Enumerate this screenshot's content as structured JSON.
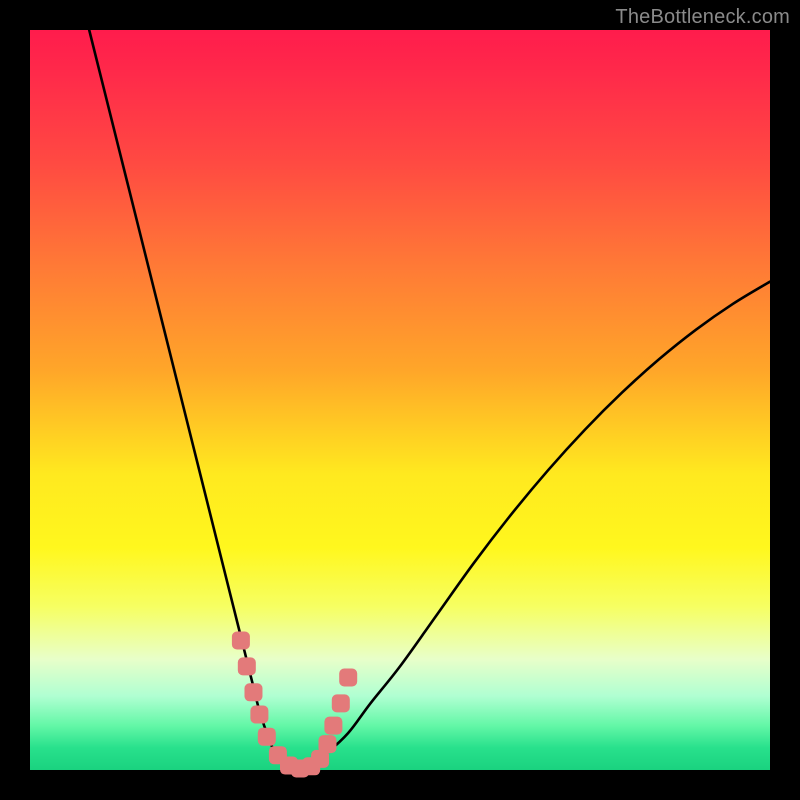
{
  "watermark": "TheBottleneck.com",
  "chart_data": {
    "type": "line",
    "title": "",
    "xlabel": "",
    "ylabel": "",
    "xlim": [
      0,
      100
    ],
    "ylim": [
      0,
      100
    ],
    "grid": false,
    "legend": false,
    "series": [
      {
        "name": "bottleneck-curve",
        "color": "#000000",
        "x": [
          8,
          10,
          12,
          14,
          16,
          18,
          20,
          22,
          24,
          26,
          27,
          28,
          29,
          30,
          31,
          32,
          33,
          34,
          35,
          36,
          37,
          38,
          40,
          43,
          46,
          50,
          55,
          60,
          65,
          70,
          75,
          80,
          85,
          90,
          95,
          100
        ],
        "y": [
          100,
          92,
          84,
          76,
          68,
          60,
          52,
          44,
          36,
          28,
          24,
          20,
          16,
          12,
          8,
          5,
          2.5,
          1,
          0.3,
          0,
          0.2,
          0.8,
          2.2,
          5,
          9,
          14,
          21,
          28,
          34.5,
          40.5,
          46,
          51,
          55.5,
          59.5,
          63,
          66
        ]
      },
      {
        "name": "highlight-dots",
        "color": "#e37a7a",
        "style": "markers",
        "x": [
          28.5,
          29.3,
          30.2,
          31.0,
          32.0,
          33.5,
          35.0,
          36.5,
          38.0,
          39.2,
          40.2,
          41.0,
          42.0,
          43.0
        ],
        "y": [
          17.5,
          14.0,
          10.5,
          7.5,
          4.5,
          2.0,
          0.6,
          0.2,
          0.5,
          1.5,
          3.5,
          6.0,
          9.0,
          12.5
        ]
      }
    ],
    "background_gradient_stops": [
      {
        "pos": 0.0,
        "color": "#ff1c4c"
      },
      {
        "pos": 0.18,
        "color": "#ff4a42"
      },
      {
        "pos": 0.46,
        "color": "#ffa629"
      },
      {
        "pos": 0.7,
        "color": "#fff71e"
      },
      {
        "pos": 0.9,
        "color": "#b0ffd2"
      },
      {
        "pos": 1.0,
        "color": "#1ad27f"
      }
    ]
  }
}
